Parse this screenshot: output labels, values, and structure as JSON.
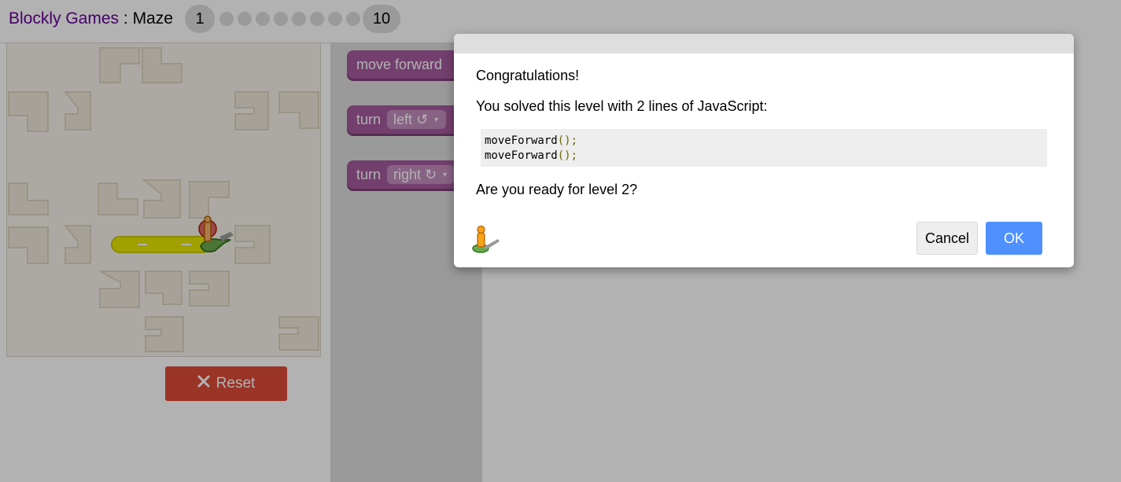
{
  "header": {
    "app_name": "Blockly Games",
    "separator": " : ",
    "game_name": "Maze",
    "levels": {
      "first": "1",
      "last": "10",
      "dot_count": 8
    }
  },
  "maze": {
    "reset_label": "Reset",
    "reset_icon": "close-icon"
  },
  "toolbox": {
    "blocks": [
      {
        "label": "move forward"
      },
      {
        "label": "turn",
        "dropdown": "left ↺"
      },
      {
        "label": "turn",
        "dropdown": "right ↻"
      }
    ]
  },
  "dialog": {
    "congrats": "Congratulations!",
    "solved_text": "You solved this level with 2 lines of JavaScript:",
    "code_lines": [
      {
        "name": "moveForward",
        "punct": "();"
      },
      {
        "name": "moveForward",
        "punct": "();"
      }
    ],
    "ready_text": "Are you ready for level 2?",
    "cancel_label": "Cancel",
    "ok_label": "OK",
    "avatar_icon": "pegman-icon"
  },
  "colors": {
    "accent": "#4d90fe",
    "reset": "#dd4b39",
    "block": "#a55b9e",
    "app_name": "#660099",
    "path": "#e6e600"
  }
}
